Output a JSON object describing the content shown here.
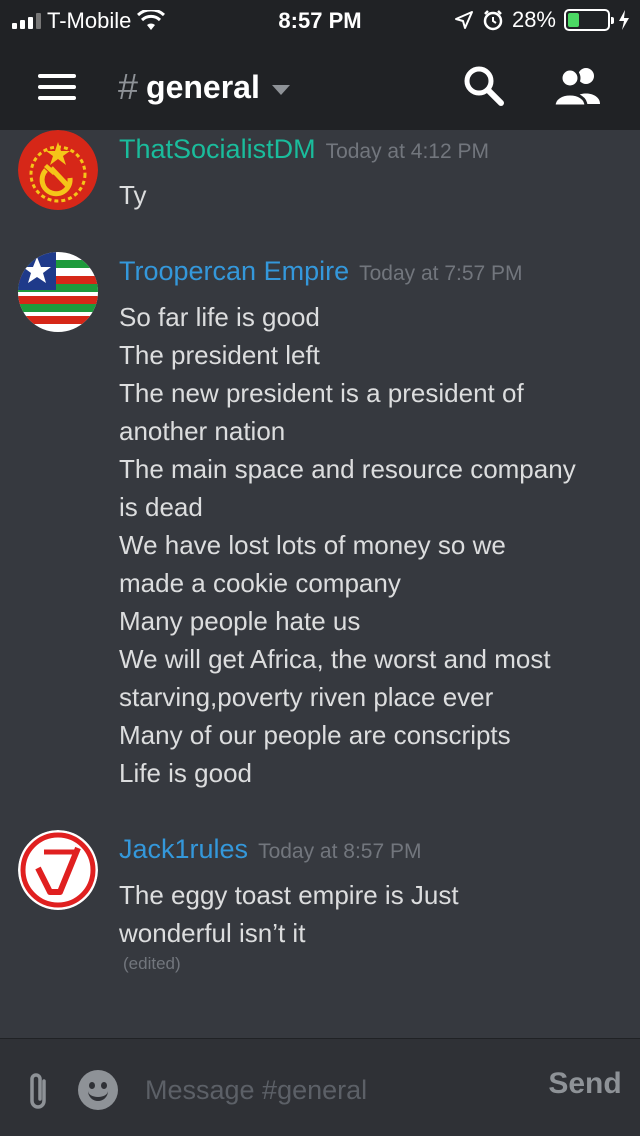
{
  "status_bar": {
    "carrier": "T-Mobile",
    "time": "8:57 PM",
    "battery_percent": "28%",
    "battery_level": 0.28,
    "icons": [
      "signal-icon",
      "wifi-icon",
      "location-icon",
      "alarm-icon",
      "battery-icon",
      "charging-icon"
    ]
  },
  "header": {
    "hash": "#",
    "channel_name": "general",
    "icons": [
      "menu-icon",
      "chevron-down-icon",
      "search-icon",
      "members-icon"
    ]
  },
  "messages": [
    {
      "username": "ThatSocialistDM",
      "username_color": "#1abc9c",
      "timestamp": "Today at 4:12 PM",
      "lines": [
        "Ty"
      ]
    },
    {
      "username": "Troopercan Empire",
      "username_color": "#3498db",
      "timestamp": "Today at 7:57 PM",
      "lines": [
        "So far life is good",
        "The president left",
        "The new president is a president of",
        "another nation",
        "The main space and resource company",
        "is dead",
        "We have lost lots of money so we",
        "made a cookie company",
        "Many people hate us",
        "We will get Africa, the worst and most",
        "starving,poverty riven  place ever",
        "Many of our people are conscripts",
        "Life is good"
      ]
    },
    {
      "username": "Jack1rules",
      "username_color": "#3498db",
      "timestamp": "Today at 8:57 PM",
      "lines": [
        "The eggy toast empire is Just",
        "wonderful isn’t it"
      ],
      "edited": "(edited)"
    }
  ],
  "composer": {
    "placeholder": "Message #general",
    "send_label": "Send",
    "icons": [
      "attachment-icon",
      "emoji-icon"
    ]
  },
  "colors": {
    "background": "#36393f",
    "header": "#202225",
    "muted": "#72767d"
  }
}
